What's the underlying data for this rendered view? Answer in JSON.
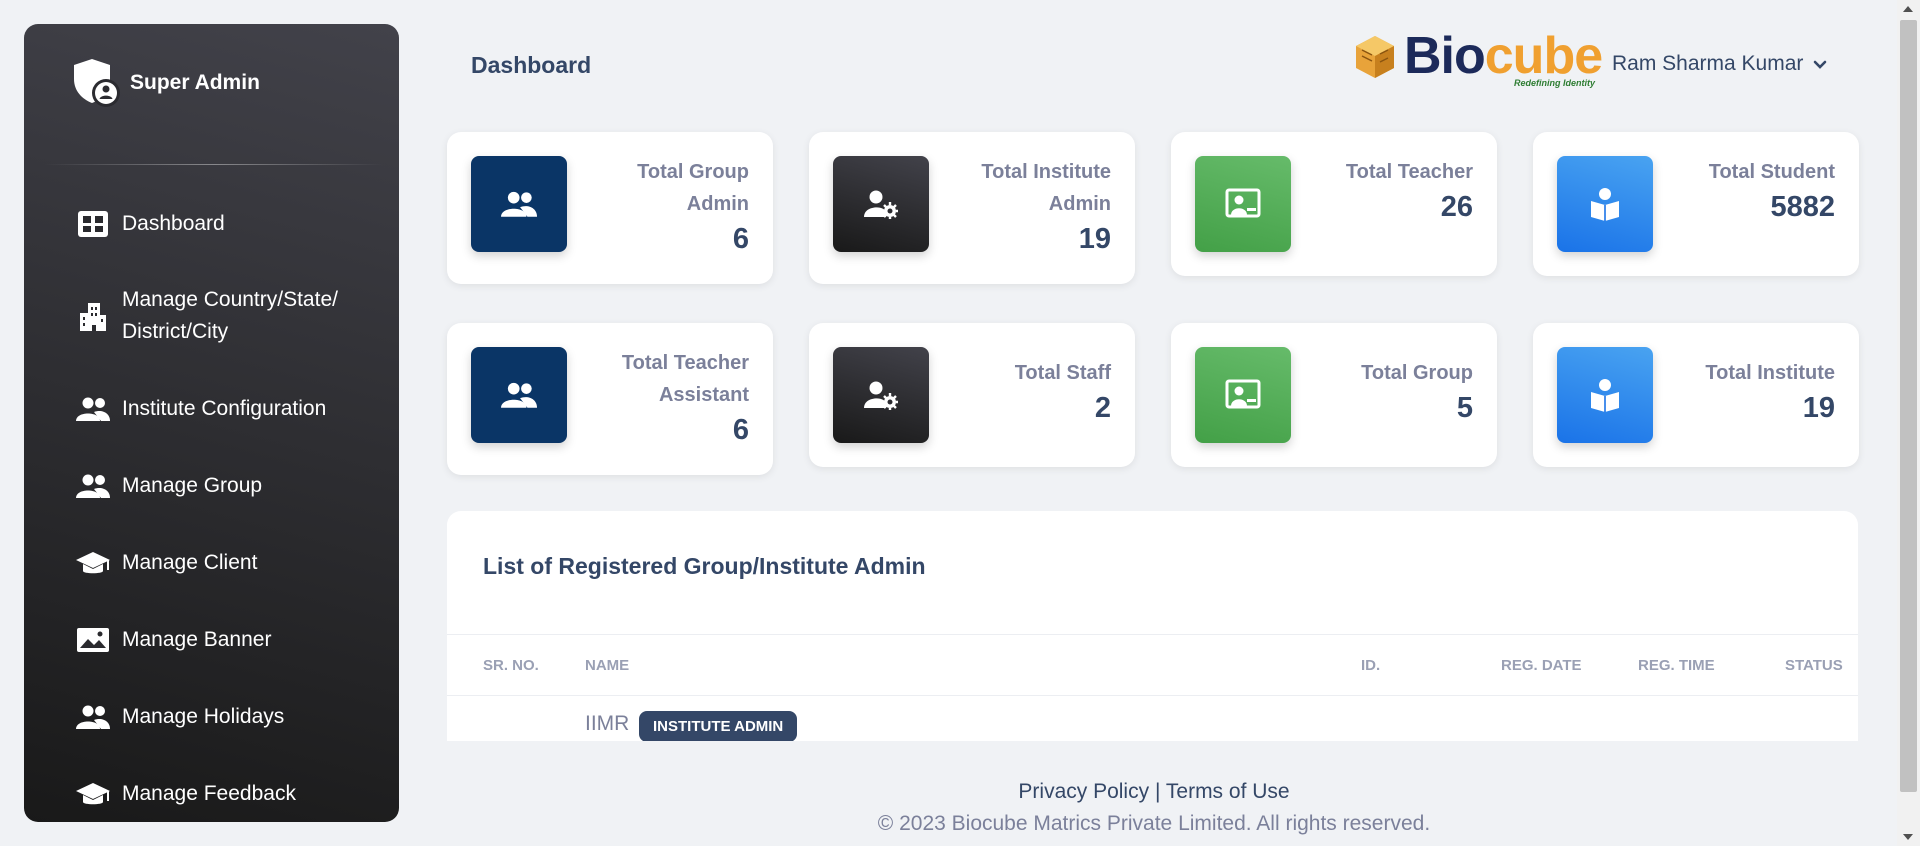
{
  "sidebar": {
    "brand": "Super Admin",
    "brand_icon": "shield-user-icon",
    "items": [
      {
        "label": "Dashboard",
        "icon": "dashboard-icon"
      },
      {
        "label": "Manage Country/State/ District/City",
        "icon": "city-icon"
      },
      {
        "label": "Institute Configuration",
        "icon": "users-icon"
      },
      {
        "label": "Manage Group",
        "icon": "users-icon"
      },
      {
        "label": "Manage Client",
        "icon": "graduation-cap-icon"
      },
      {
        "label": "Manage Banner",
        "icon": "image-icon"
      },
      {
        "label": "Manage Holidays",
        "icon": "users-icon"
      },
      {
        "label": "Manage Feedback",
        "icon": "graduation-cap-icon"
      }
    ]
  },
  "header": {
    "title": "Dashboard",
    "logo": {
      "part1": "Bio",
      "part2": "cube",
      "tagline": "Redefining Identity"
    },
    "user_name": "Ram Sharma Kumar"
  },
  "stats": [
    {
      "label": "Total Group Admin",
      "value": "6",
      "icon": "users-icon",
      "color": "#0a3566"
    },
    {
      "label": "Total Institute Admin",
      "value": "19",
      "icon": "user-gear-icon",
      "color": "#2b2b30"
    },
    {
      "label": "Total Teacher",
      "value": "26",
      "icon": "teacher-board-icon",
      "color": "#4caf50"
    },
    {
      "label": "Total Student",
      "value": "5882",
      "icon": "book-reader-icon",
      "color": "#1a73e8"
    },
    {
      "label": "Total Teacher Assistant",
      "value": "6",
      "icon": "users-icon",
      "color": "#0a3566"
    },
    {
      "label": "Total Staff",
      "value": "2",
      "icon": "user-gear-icon",
      "color": "#2b2b30"
    },
    {
      "label": "Total Group",
      "value": "5",
      "icon": "teacher-board-icon",
      "color": "#4caf50"
    },
    {
      "label": "Total Institute",
      "value": "19",
      "icon": "book-reader-icon",
      "color": "#1a73e8"
    }
  ],
  "table": {
    "title": "List of Registered Group/Institute Admin",
    "columns": [
      "SR. NO.",
      "NAME",
      "ID.",
      "REG. DATE",
      "REG. TIME",
      "STATUS"
    ],
    "rows": [
      {
        "name": "IIMR",
        "badge": "INSTITUTE ADMIN"
      }
    ]
  },
  "footer": {
    "privacy": "Privacy Policy",
    "separator": "|",
    "terms": "Terms of Use",
    "copyright": "© 2023 Biocube Matrics Private Limited. All rights reserved."
  }
}
